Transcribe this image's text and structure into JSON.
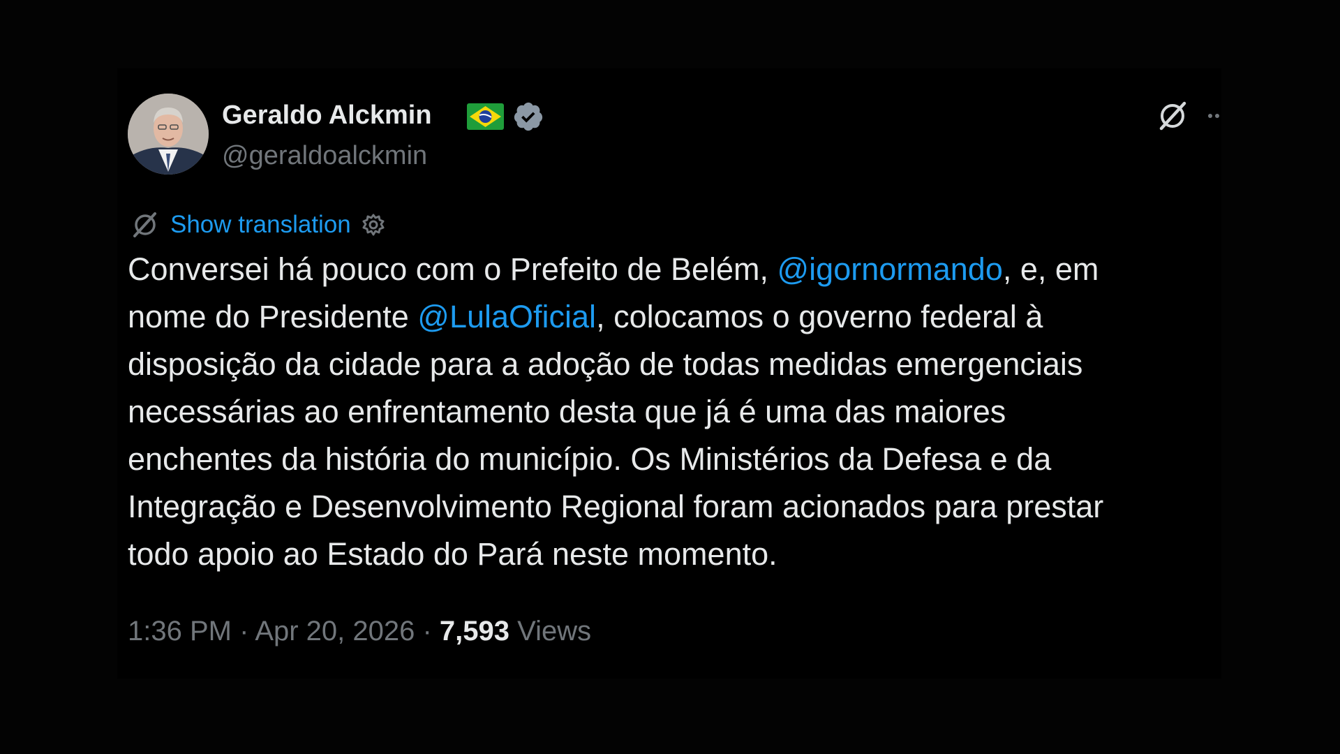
{
  "author": {
    "display_name": "Geraldo Alckmin",
    "handle": "@geraldoalckmin",
    "flag_icon": "brazil-flag-icon",
    "verified_icon": "verified-badge-icon",
    "verified_color": "#8b98a5"
  },
  "header_actions": {
    "grok_icon": "grok-icon",
    "more_icon": "more-dots-icon"
  },
  "translation": {
    "label": "Show translation",
    "icon": "translate-icon",
    "settings_icon": "gear-icon"
  },
  "tweet": {
    "lines": [
      [
        {
          "text": "Conversei há pouco com o Prefeito de Belém, "
        },
        {
          "text": "@igornormando",
          "mention": true
        },
        {
          "text": ", e, em"
        }
      ],
      [
        {
          "text": "nome do Presidente "
        },
        {
          "text": "@LulaOficial",
          "mention": true
        },
        {
          "text": ", colocamos o governo federal à"
        }
      ],
      [
        {
          "text": "disposição da cidade para a adoção de todas medidas emergenciais"
        }
      ],
      [
        {
          "text": "necessárias ao enfrentamento desta que já é uma das maiores"
        }
      ],
      [
        {
          "text": "enchentes da história do município. Os Ministérios da Defesa e da"
        }
      ],
      [
        {
          "text": "Integração e Desenvolvimento Regional foram acionados para prestar"
        }
      ],
      [
        {
          "text": "todo apoio ao Estado do Pará neste momento."
        }
      ]
    ]
  },
  "meta": {
    "time": "1:36 PM",
    "separator": " · ",
    "date": "Apr 20, 2026",
    "views_count": "7,593",
    "views_label": " Views"
  },
  "colors": {
    "background": "#000000",
    "text": "#e7e9ea",
    "secondary": "#71767b",
    "link": "#1d9bf0"
  }
}
